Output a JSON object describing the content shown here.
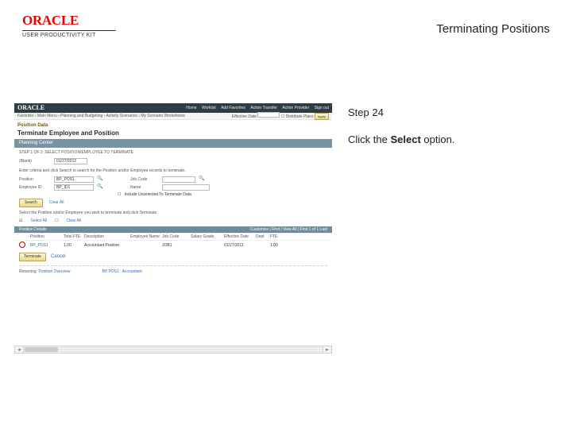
{
  "brand": {
    "name": "ORACLE",
    "product": "USER PRODUCTIVITY KIT"
  },
  "topic_title": "Terminating Positions",
  "instruction": {
    "step_label": "Step 24",
    "prefix": "Click the ",
    "bold": "Select",
    "suffix": " option."
  },
  "shot": {
    "nav_logo": "ORACLE",
    "nav_links": [
      "Home",
      "Worklist",
      "Add Favorites",
      "Action Transfer",
      "Action Provider",
      "Sign out"
    ],
    "breadcrumb": "Favorites › Main Menu › Planning and Budgeting › Activity Scenarios › My Scenario Worksheets",
    "bc_right": {
      "effective": "Effective Date",
      "ck_label": "Distribute Plans",
      "apply": "Apply"
    },
    "section_title": "Position Data",
    "page_heading": "Terminate Employee and Position",
    "panel_label": "Planning Center",
    "step_line": "STEP 1 OF 2: SELECT POSITION/EMPLOYEE TO TERMINATE",
    "date_field": {
      "label": "(Blank)",
      "value": "01/27/2012"
    },
    "criteria_hint": "Enter criteria and click Search to search for the Position and/or Employee records to terminate.",
    "fields": {
      "position_label": "Position",
      "position_value": "BP_POS1",
      "jobcode_label": "Job Code",
      "employee_label": "Employee ID",
      "employee_value": "BP_ID1",
      "name_label": "Name",
      "include_label": "Include Unselected To Terminate Data"
    },
    "search_btn": "Search",
    "clear_link": "Clear All",
    "select_hint": "Select the Position and/or Employee you wish to terminate and click Terminate.",
    "selectall": "Select All",
    "clear2": "Clear All",
    "results_title": "Position Details",
    "results_right": "Customize | Find | View All | First 1 of 1 Last",
    "columns": [
      "",
      "Position",
      "Total FTE",
      "Description",
      "Employee Name",
      "Job Code",
      "Salary Grade",
      "Effective Date",
      "Dept",
      "FTE"
    ],
    "row": {
      "position": "BP_POS1",
      "fte": "1.00",
      "desc": "Accountant Position",
      "emp": "",
      "job": "JOB1",
      "sal": "",
      "eff": "01/27/2011",
      "dept": "",
      "ftecap": "1.00"
    },
    "terminate_btn": "Terminate",
    "cancel_link": "Cancel",
    "return_label": "Returning",
    "return_link": "Position Overview",
    "ref_label": "",
    "ref_value": "BP POS1 : Accountant"
  }
}
